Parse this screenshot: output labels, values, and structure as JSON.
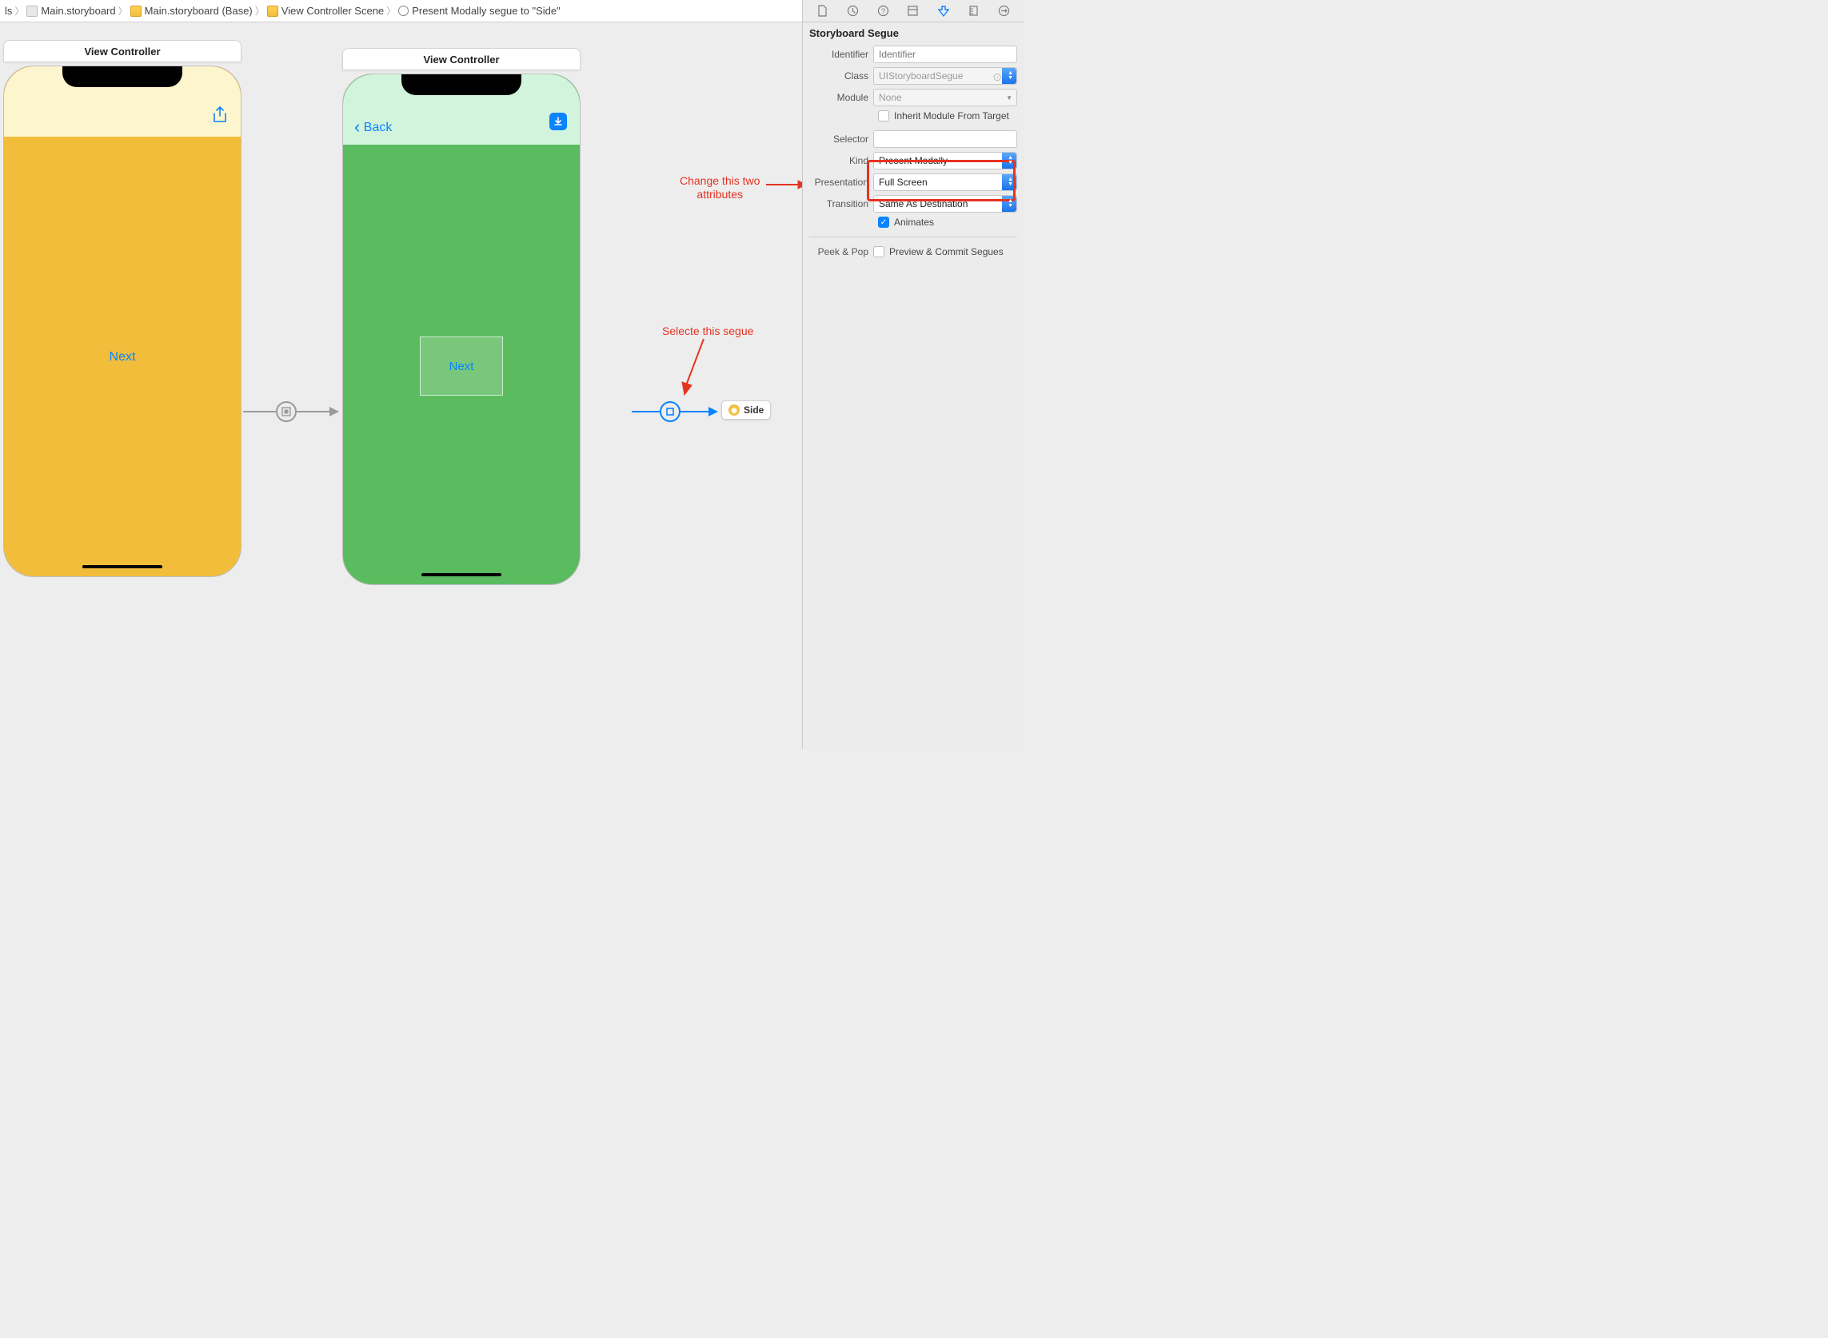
{
  "breadcrumbs": {
    "item0": "ls",
    "item1": "Main.storyboard",
    "item2": "Main.storyboard (Base)",
    "item3": "View Controller Scene",
    "item4": "Present Modally segue to \"Side\""
  },
  "canvas": {
    "scene1": {
      "title": "View Controller",
      "share_glyph": "⇪",
      "next_label": "Next"
    },
    "scene2": {
      "title": "View Controller",
      "back_label": "Back",
      "next_label": "Next",
      "dl_glyph": "⬇"
    },
    "side_chip": "Side",
    "segue_icon1": "▣",
    "segue_icon2": "▢"
  },
  "annotations": {
    "change_attrs": "Change this two\nattributes",
    "select_segue": "Selecte this segue"
  },
  "inspector": {
    "section_title": "Storyboard Segue",
    "labels": {
      "identifier": "Identifier",
      "class": "Class",
      "module": "Module",
      "inherit": "Inherit Module From Target",
      "selector": "Selector",
      "kind": "Kind",
      "presentation": "Presentation",
      "transition": "Transition",
      "animates": "Animates",
      "peekpop_label": "Peek & Pop",
      "peekpop_check": "Preview & Commit Segues"
    },
    "values": {
      "identifier_ph": "Identifier",
      "class_ph": "UIStoryboardSegue",
      "module_ph": "None",
      "kind": "Present Modally",
      "presentation": "Full Screen",
      "transition": "Same As Destination"
    }
  },
  "icons": {
    "chev_left": "‹",
    "chev_right": "›",
    "warn": "⚠︎",
    "lines": "≣",
    "panel": "◫"
  }
}
